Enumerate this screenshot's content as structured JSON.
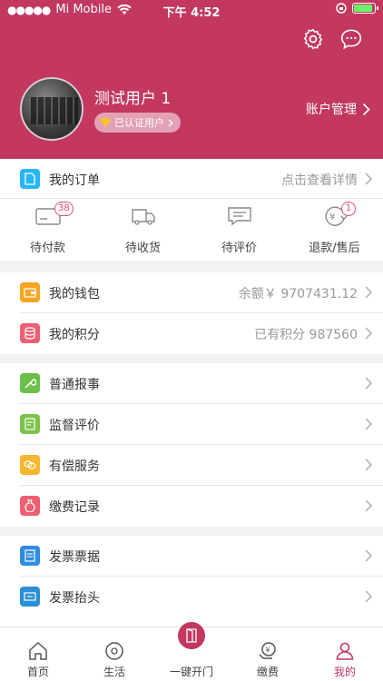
{
  "status": {
    "carrier": "Mi Mobile",
    "time": "下午 4:52"
  },
  "colors": {
    "brand": "#c2385f",
    "badge": "#e34d6c",
    "battery": "#6ef16a"
  },
  "header": {
    "icons": [
      "settings-icon",
      "message-icon"
    ],
    "username": "测试用户 1",
    "verified_label": "已认证用户",
    "account_link": "账户管理"
  },
  "orders": {
    "title": "我的订单",
    "detail": "点击查看详情",
    "items": [
      {
        "label": "待付款",
        "badge": "38",
        "icon": "card-icon"
      },
      {
        "label": "待收货",
        "badge": "",
        "icon": "truck-icon"
      },
      {
        "label": "待评价",
        "badge": "",
        "icon": "comment-icon"
      },
      {
        "label": "退款/售后",
        "badge": "1",
        "icon": "refund-icon"
      }
    ]
  },
  "wallet": {
    "label": "我的钱包",
    "value": "余额￥ 9707431.12"
  },
  "points": {
    "label": "我的积分",
    "value": "已有积分 987560"
  },
  "menu1": [
    {
      "label": "普通报事",
      "icon": "wrench-icon",
      "color": "#6cc04a"
    },
    {
      "label": "监督评价",
      "icon": "review-icon",
      "color": "#7cc34b"
    },
    {
      "label": "有偿服务",
      "icon": "service-icon",
      "color": "#f5b731"
    },
    {
      "label": "缴费记录",
      "icon": "payment-record-icon",
      "color": "#ee5f73"
    }
  ],
  "menu2": [
    {
      "label": "发票票据",
      "icon": "invoice-icon",
      "color": "#2f8ce0"
    },
    {
      "label": "发票抬头",
      "icon": "invoice-title-icon",
      "color": "#2a8fd5"
    }
  ],
  "tabs": [
    {
      "label": "首页",
      "icon": "home-icon"
    },
    {
      "label": "生活",
      "icon": "life-icon"
    },
    {
      "label": "一键开门",
      "icon": "door-icon"
    },
    {
      "label": "缴费",
      "icon": "pay-icon"
    },
    {
      "label": "我的",
      "icon": "profile-icon"
    }
  ]
}
